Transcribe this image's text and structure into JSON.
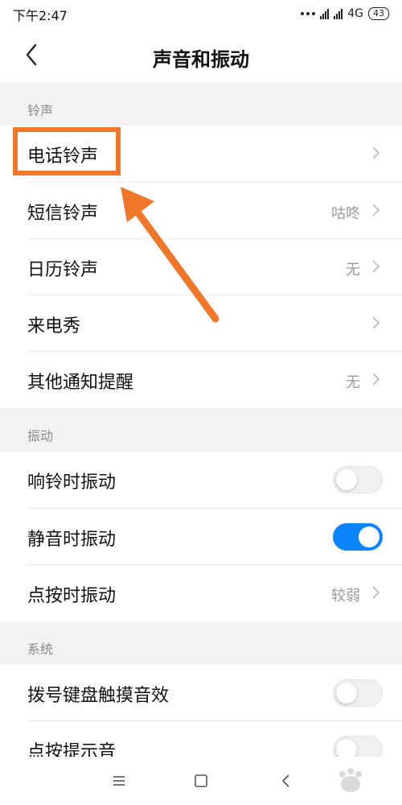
{
  "status_bar": {
    "time": "下午2:47",
    "network": "4G",
    "battery": "43"
  },
  "header": {
    "title": "声音和振动",
    "back_icon": "chevron-left-icon"
  },
  "sections": {
    "ringtone": {
      "label": "铃声",
      "items": [
        {
          "label": "电话铃声",
          "value": ""
        },
        {
          "label": "短信铃声",
          "value": "咕咚"
        },
        {
          "label": "日历铃声",
          "value": "无"
        },
        {
          "label": "来电秀",
          "value": ""
        },
        {
          "label": "其他通知提醒",
          "value": "无"
        }
      ]
    },
    "vibration": {
      "label": "振动",
      "items": [
        {
          "label": "响铃时振动",
          "toggle": false
        },
        {
          "label": "静音时振动",
          "toggle": true
        },
        {
          "label": "点按时振动",
          "value": "较弱"
        }
      ]
    },
    "system": {
      "label": "系统",
      "items": [
        {
          "label": "拨号键盘触摸音效",
          "toggle": false
        },
        {
          "label": "点按提示音",
          "toggle": false
        }
      ]
    }
  },
  "colors": {
    "accent": "#0d84ff",
    "annotation": "#f0772a",
    "background_gap": "#f2f2f2"
  },
  "navbar": {
    "icons": [
      "menu-icon",
      "home-square-icon",
      "back-triangle-icon"
    ]
  }
}
